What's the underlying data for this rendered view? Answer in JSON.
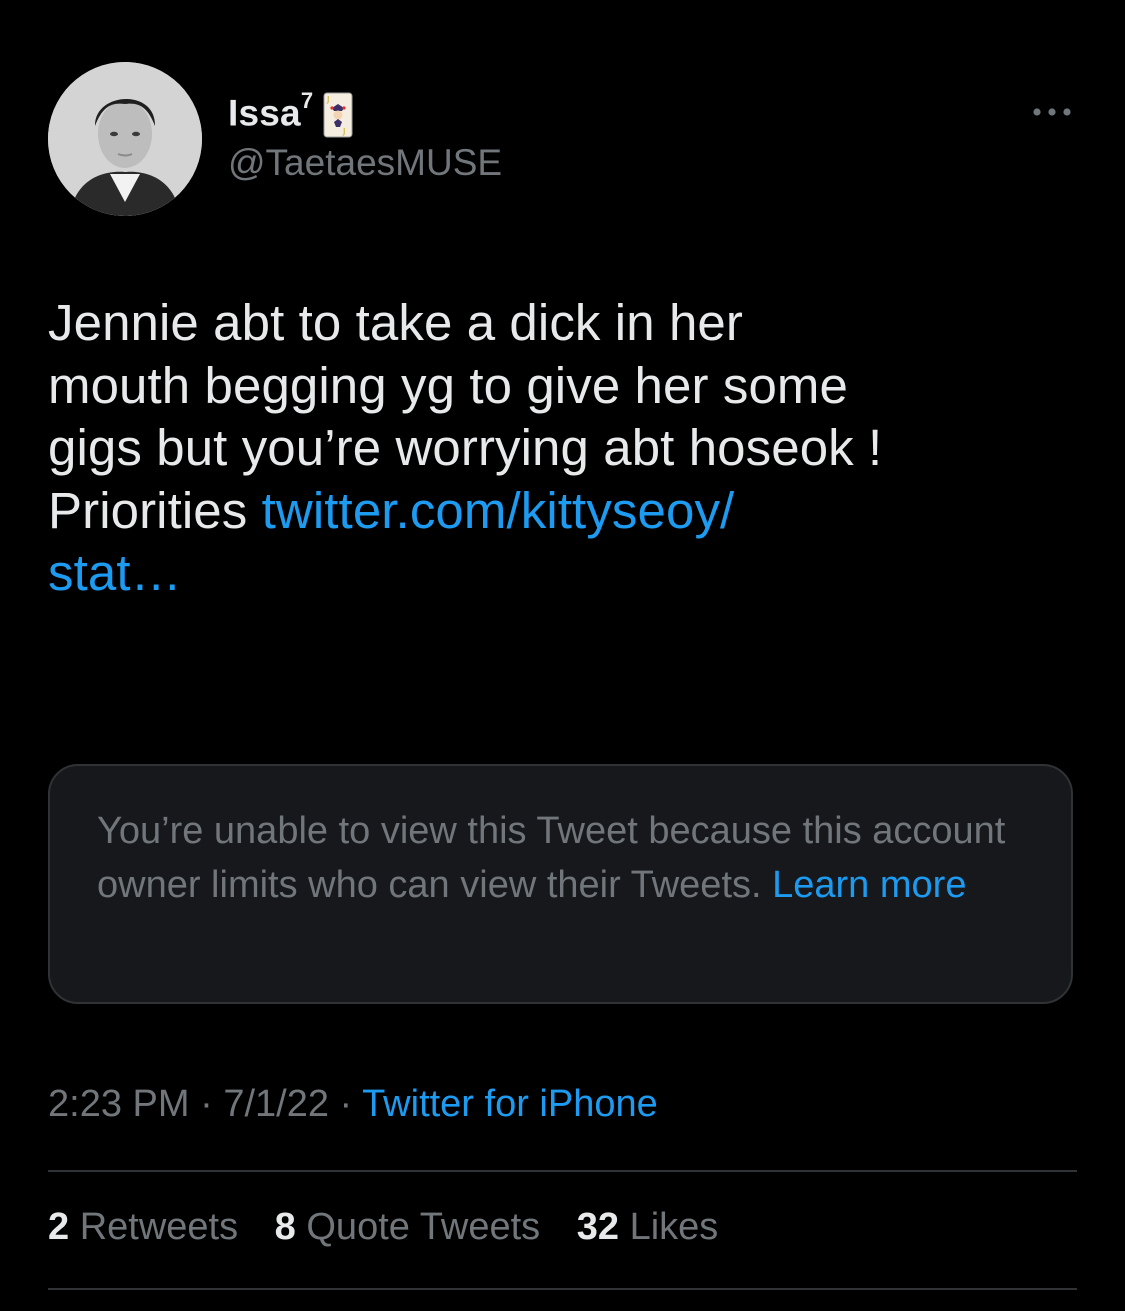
{
  "author": {
    "display_name": "Issa",
    "name_suffix": "7",
    "name_emoji": "joker-card-icon",
    "handle": "@TaetaesMUSE",
    "avatar": "profile-avatar"
  },
  "tweet": {
    "lines": [
      "Jennie abt to take a dick in her",
      "mouth begging yg to give her some",
      "gigs but you’re worrying abt hoseok !",
      "Priorities"
    ],
    "link_line1": "twitter.com/kittyseoy/",
    "link_line2": "stat…"
  },
  "quoted": {
    "unavailable_text": "You’re unable to view this Tweet because this account owner limits who can view their Tweets.",
    "learn_more": "Learn more"
  },
  "meta": {
    "time": "2:23 PM",
    "date": "7/1/22",
    "separator": "·",
    "source": "Twitter for iPhone"
  },
  "stats": {
    "retweets_count": "2",
    "retweets_label": "Retweets",
    "quotes_count": "8",
    "quotes_label": "Quote Tweets",
    "likes_count": "32",
    "likes_label": "Likes"
  },
  "colors": {
    "background": "#000000",
    "text": "#e7e9ea",
    "secondary": "#71767b",
    "link": "#1d9bf0",
    "border": "#2f3336"
  }
}
